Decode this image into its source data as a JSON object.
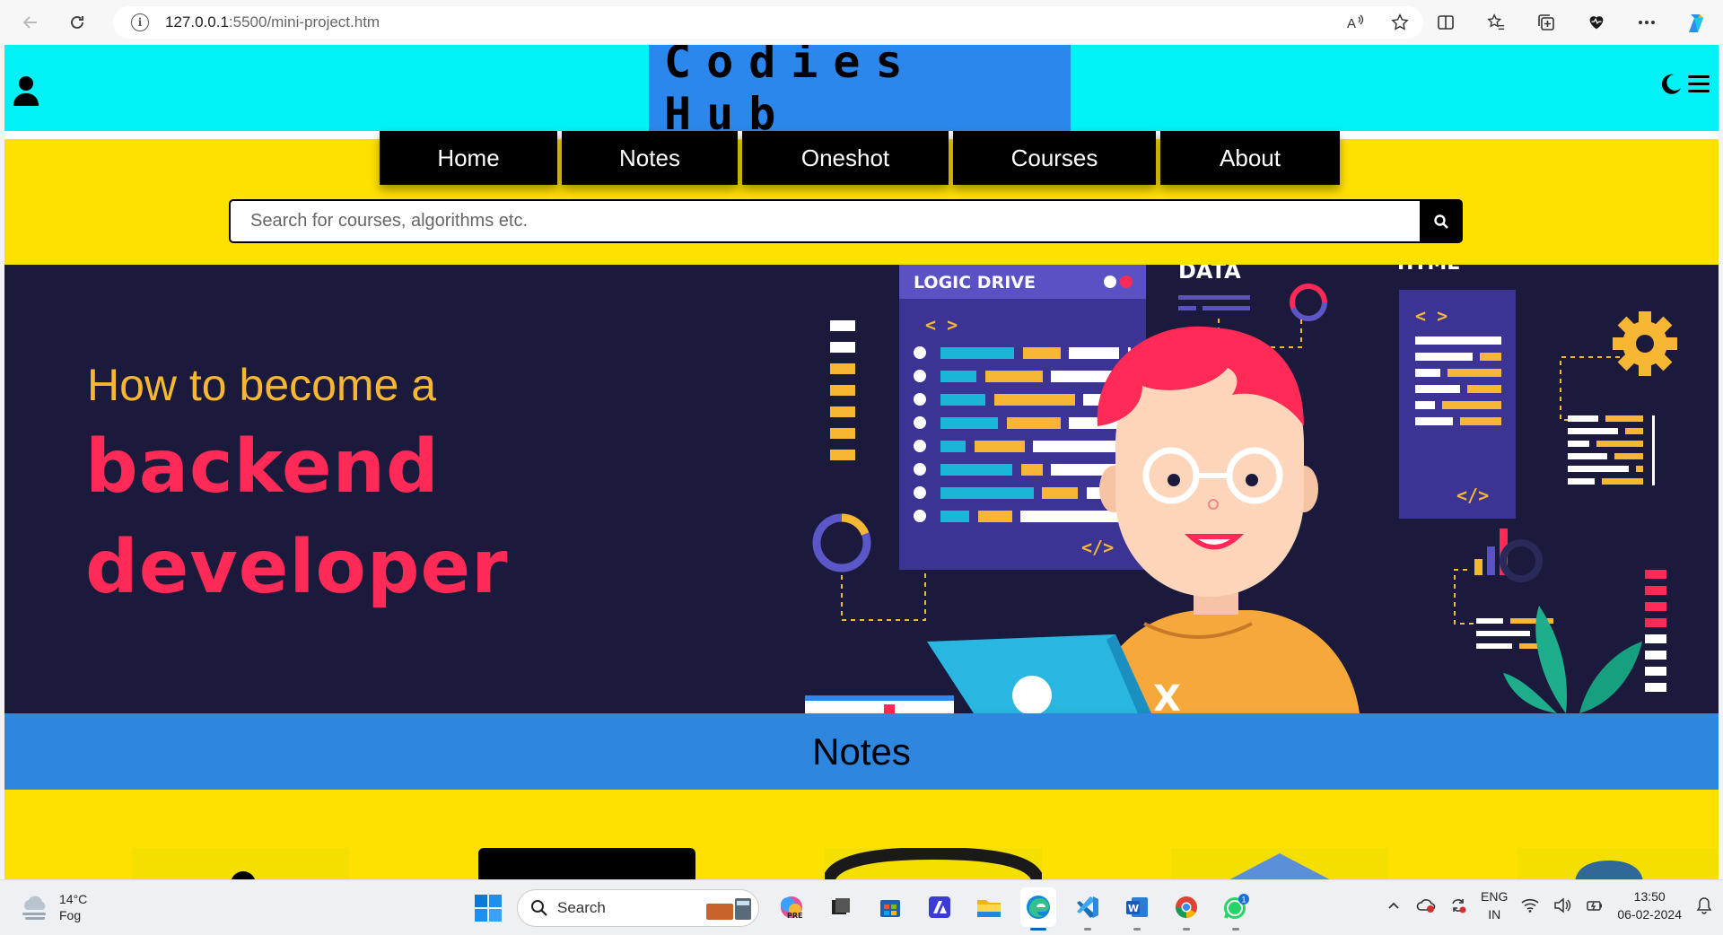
{
  "browser": {
    "url_host": "127.0.0.1",
    "url_path": ":5500/mini-project.htm"
  },
  "site": {
    "brand": "Codies Hub",
    "nav": [
      "Home",
      "Notes",
      "Oneshot",
      "Courses",
      "About"
    ],
    "search_placeholder": "Search for courses, algorithms etc.",
    "hero": {
      "line1": "How to become a",
      "line2": "backend",
      "line3": "developer",
      "art_labels": {
        "logic_drive": "LOGIC DRIVE",
        "data": "DATA",
        "html": "HTML",
        "code_tag": "< >",
        "close_tag": "</>",
        "x_mark": "X"
      }
    },
    "section_title": "Notes"
  },
  "taskbar": {
    "weather_temp": "14°C",
    "weather_desc": "Fog",
    "search_label": "Search",
    "lang_top": "ENG",
    "lang_bottom": "IN",
    "time": "13:50",
    "date": "06-02-2024",
    "whatsapp_badge": "1"
  },
  "colors": {
    "header_cyan": "#00f1f6",
    "brand_blue": "#2b87eb",
    "yellow": "#ffe100",
    "hero_bg": "#1b1a3c",
    "hero_red": "#ff2a55",
    "hero_orange": "#f7b732",
    "notes_blue": "#2e86de"
  }
}
